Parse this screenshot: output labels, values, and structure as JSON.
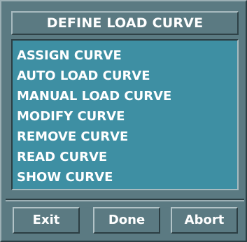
{
  "dialog": {
    "title": "DEFINE LOAD CURVE"
  },
  "menu": {
    "items": [
      "ASSIGN CURVE",
      "AUTO LOAD CURVE",
      "MANUAL LOAD CURVE",
      "MODIFY CURVE",
      "REMOVE CURVE",
      "READ CURVE",
      "SHOW CURVE"
    ]
  },
  "buttons": {
    "exit": "Exit",
    "done": "Done",
    "abort": "Abort"
  },
  "colors": {
    "panel": "#5b7a82",
    "list_background": "#3e8fa3",
    "text": "#ffffff"
  }
}
